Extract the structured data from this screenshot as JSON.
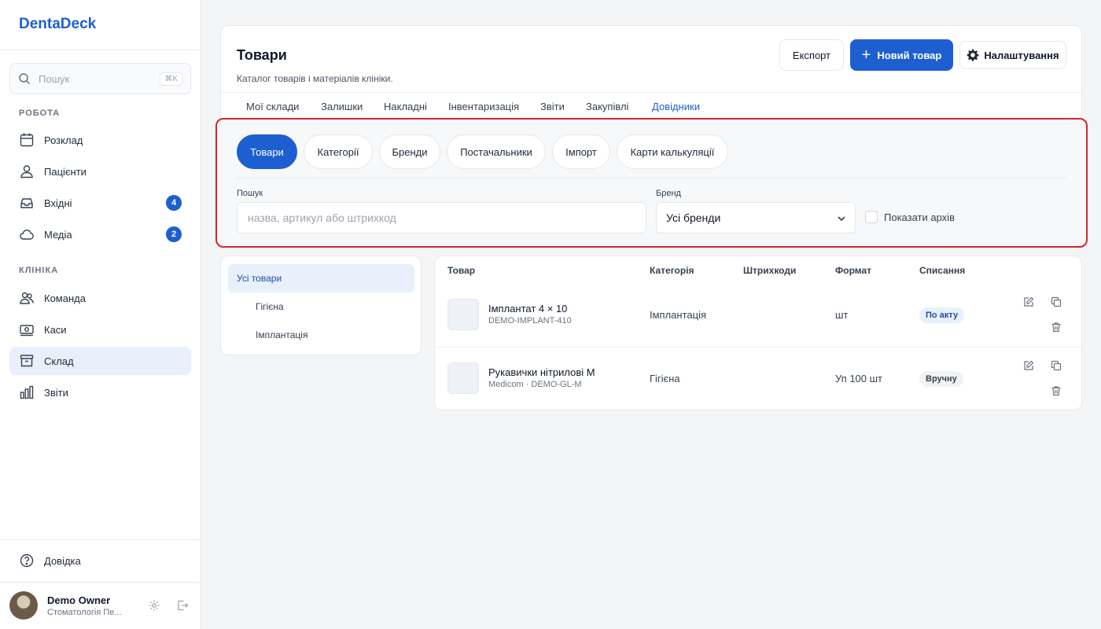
{
  "app": {
    "name": "DentaDeck"
  },
  "search": {
    "placeholder": "Пошук",
    "shortcut": "⌘K"
  },
  "sidebar": {
    "section_work": "РОБОТА",
    "section_clinic": "КЛІНІКА",
    "items": [
      {
        "label": "Розклад",
        "icon": "calendar-icon"
      },
      {
        "label": "Пацієнти",
        "icon": "patients-icon"
      },
      {
        "label": "Вхідні",
        "icon": "inbox-icon",
        "badge": "4"
      },
      {
        "label": "Медіа",
        "icon": "cloud-icon",
        "badge": "2"
      },
      {
        "label": "Команда",
        "icon": "team-icon"
      },
      {
        "label": "Каси",
        "icon": "cash-register-icon"
      },
      {
        "label": "Склад",
        "icon": "warehouse-icon",
        "active": true
      },
      {
        "label": "Звіти",
        "icon": "reports-icon"
      }
    ],
    "help": "Довідка"
  },
  "user": {
    "name": "Demo Owner",
    "clinic": "Стоматологія Пе..."
  },
  "header": {
    "title": "Товари",
    "subtitle": "Каталог товарів і матеріалів клініки.",
    "export_label": "Експорт",
    "new_label": "Новий товар",
    "settings_label": "Налаштування"
  },
  "tabs": [
    "Мої склади",
    "Залишки",
    "Накладні",
    "Інвентаризація",
    "Звіти",
    "Закупівлі",
    "Довідники"
  ],
  "active_tab": "Довідники",
  "subtabs": [
    "Товари",
    "Категорії",
    "Бренди",
    "Постачальники",
    "Імпорт",
    "Карти калькуляції"
  ],
  "active_subtab": "Товари",
  "filters": {
    "search_label": "Пошук",
    "search_placeholder": "назва, артикул або штрихкод",
    "brand_label": "Бренд",
    "brand_value": "Усі бренди",
    "archive_label": "Показати архів",
    "archive_checked": false
  },
  "categories": {
    "all": "Усі товари",
    "children": [
      "Гігієна",
      "Імплантація"
    ]
  },
  "table": {
    "columns": [
      "Товар",
      "Категорія",
      "Штрихкоди",
      "Формат",
      "Списання"
    ],
    "rows": [
      {
        "name": "Імплантат 4 × 10",
        "sku": "DEMO-IMPLANT-410",
        "category": "Імплантація",
        "barcodes": "",
        "format": "шт",
        "writeoff": "По акту"
      },
      {
        "name": "Рукавички нітрилові M",
        "sku": "Medicom · DEMO-GL-M",
        "category": "Гігієна",
        "barcodes": "",
        "format": "Уп 100 шт",
        "writeoff": "Вручну"
      }
    ]
  },
  "colors": {
    "accent": "#1d5fd0",
    "highlight_border": "#d4262d"
  }
}
